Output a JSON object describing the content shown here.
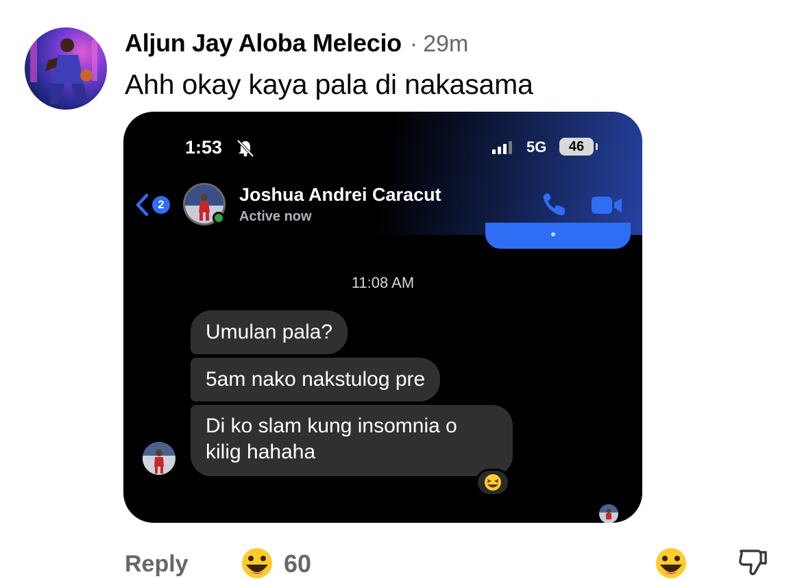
{
  "comment": {
    "author": "Aljun Jay Aloba Melecio",
    "separator": "·",
    "time_ago": "29m",
    "text": "Ahh okay kaya pala di nakasama"
  },
  "screenshot": {
    "status_bar": {
      "time": "1:53",
      "network": "5G",
      "battery": "46"
    },
    "header": {
      "back_badge_count": "2",
      "contact_name": "Joshua Andrei Caracut",
      "contact_status": "Active now"
    },
    "timestamp": "11:08 AM",
    "messages": [
      {
        "text": "Umulan pala?"
      },
      {
        "text": "5am nako nakstulog pre"
      },
      {
        "text": "Di ko slam kung insomnia o kilig hahaha"
      }
    ],
    "reaction_icon": "laughing-emoji-icon"
  },
  "footer": {
    "reply_label": "Reply",
    "reaction_count": "60"
  },
  "colors": {
    "accent_blue": "#2f6df5",
    "bubble_gray": "#303030",
    "meta_gray": "#65676b",
    "online_green": "#31a24c"
  }
}
